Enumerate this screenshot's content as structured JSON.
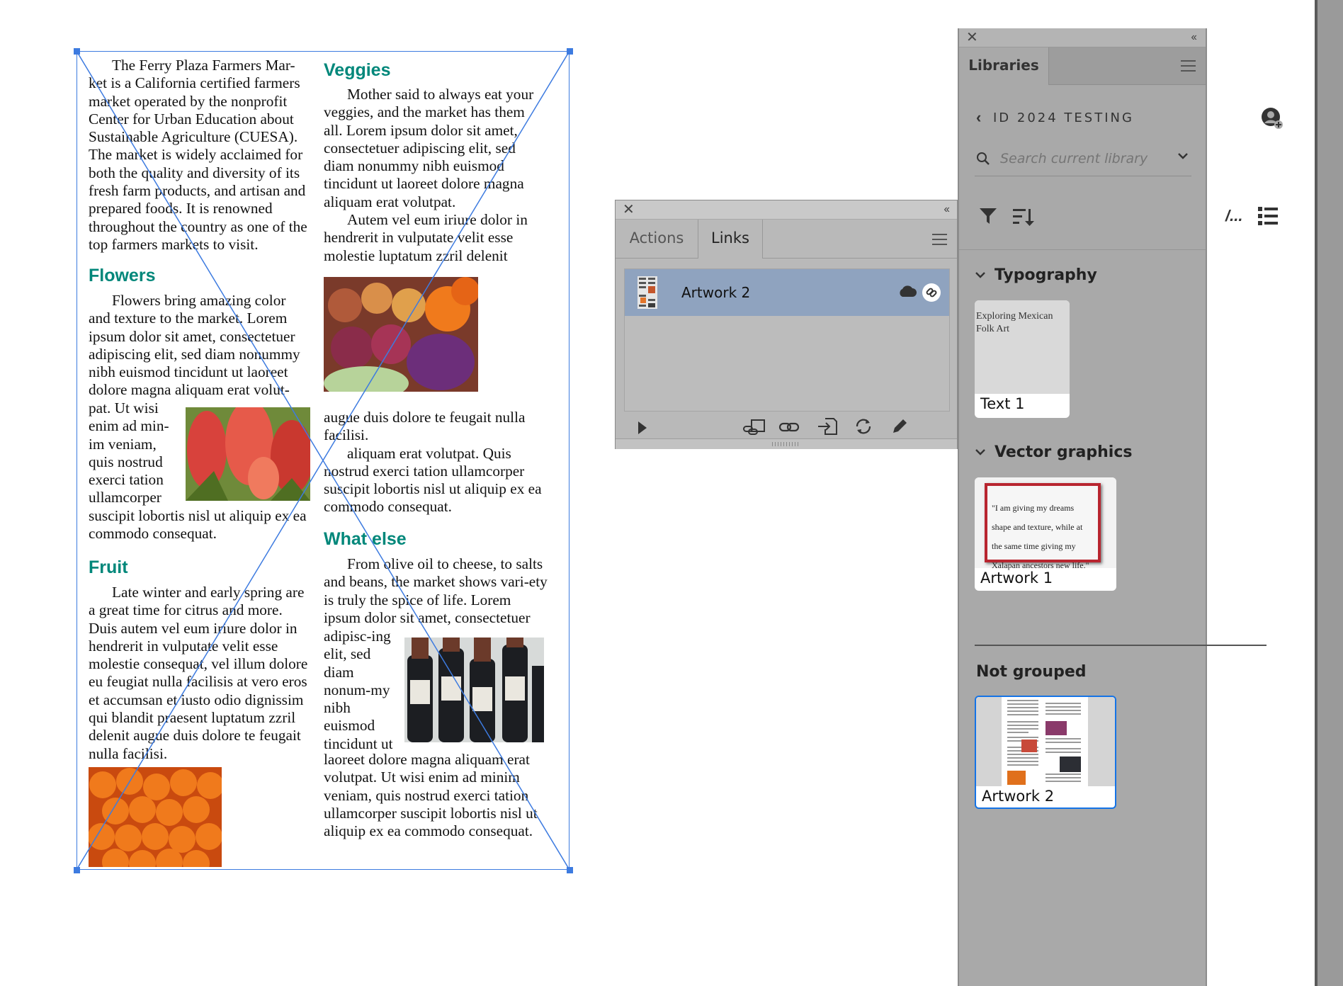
{
  "document": {
    "col1": {
      "p1": "The Ferry Plaza Farmers Mar-ket is a California certified farmers market operated by the nonprofit Center for Urban Education about Sustainable Agriculture (CUESA). The market is widely acclaimed for both the quality and diversity of its fresh farm products, and artisan and prepared foods. It is renowned throughout the country as one of the top farmers markets to visit.",
      "h_flowers": "Flowers",
      "p_flowers": "Flowers bring amazing color and texture to the market. Lorem ipsum dolor sit amet, consectetuer adipiscing elit, sed diam nonummy nibh euismod tincidunt ut laoreet dolore magna aliquam erat volut-",
      "p_flowers_wrap": "pat. Ut wisi enim ad min-im veniam, quis nostrud exerci tation ullamcorper",
      "p_flowers_end": "suscipit lobortis nisl ut aliquip ex ea commodo consequat.",
      "h_fruit": "Fruit",
      "p_fruit": "Late winter and early spring are a great time for citrus and more. Duis autem vel eum iriure dolor in hendrerit in vulputate velit esse molestie consequat, vel illum dolore eu feugiat nulla facilisis at vero eros et accumsan et iusto odio dignissim qui blandit praesent luptatum zzril delenit augue duis dolore te feugait nulla facilisi."
    },
    "col2": {
      "h_veggies": "Veggies",
      "p_veggies1": "Mother said to always eat your veggies, and the market has them all. Lorem ipsum dolor sit amet, consectetuer adipiscing elit, sed diam nonummy nibh euismod tincidunt ut laoreet dolore magna aliquam erat volutpat.",
      "p_veggies2": "Autem vel eum iriure dolor in hendrerit in vulputate velit esse molestie luptatum zzril delenit",
      "p_veggies3": "augue duis dolore te feugait nulla facilisi.",
      "p_veggies4": "aliquam erat volutpat. Quis nostrud exerci tation ullamcorper suscipit lobortis nisl ut aliquip ex ea commodo consequat.",
      "h_whatelse": "What else",
      "p_whatelse": "From olive oil to cheese, to salts and beans, the market shows vari-ety is truly the spice of life. Lorem ipsum dolor sit amet, consectetuer",
      "p_whatelse_wrap": "adipisc-ing elit, sed diam nonum-my nibh euismod tincidunt ut",
      "p_whatelse_end": "laoreet dolore magna aliquam erat volutpat. Ut wisi enim ad minim veniam, quis nostrud exerci tation ullamcorper suscipit lobortis nisl ut aliquip ex ea commodo consequat."
    }
  },
  "links_panel": {
    "tabs": [
      "Actions",
      "Links"
    ],
    "active_tab": "Links",
    "items": [
      {
        "name": "Artwork 2",
        "cloud_icon": "cloud-icon",
        "link_icon": "link-icon"
      }
    ],
    "toolbar_icons": [
      "play-icon",
      "relink-from-cc-icon",
      "relink-icon",
      "goto-link-icon",
      "update-link-icon",
      "edit-original-icon"
    ]
  },
  "libraries_panel": {
    "tab": "Libraries",
    "library_name": "ID 2024 TESTING",
    "search_placeholder": "Search current library",
    "sections": [
      {
        "title": "Typography",
        "items": [
          {
            "label": "Text 1",
            "preview": "Exploring Mexican Folk Art"
          }
        ]
      },
      {
        "title": "Vector graphics",
        "items": [
          {
            "label": "Artwork 1",
            "preview": "\"I am giving my dreams shape and texture, while at the same time giving my Xalapan ancestors new life.\""
          }
        ]
      },
      {
        "title": "Not grouped",
        "items": [
          {
            "label": "Artwork 2"
          }
        ]
      }
    ],
    "colors": {
      "accent": "#1473e6",
      "heading_teal": "#00877a",
      "selection": "#3d7be0"
    }
  }
}
